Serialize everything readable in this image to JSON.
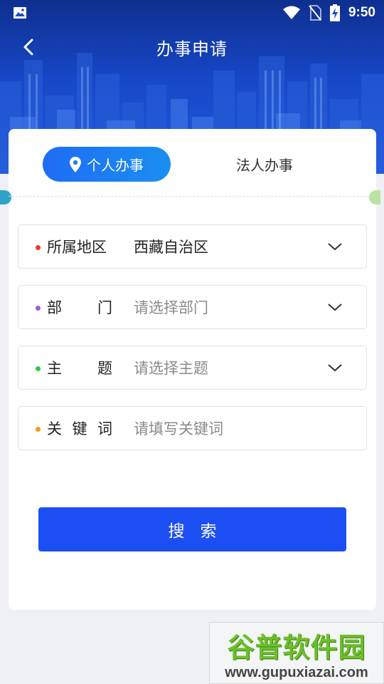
{
  "status_bar": {
    "time": "9:50",
    "icons": [
      "image-icon",
      "wifi-icon",
      "no-sim-icon",
      "battery-charging-icon"
    ]
  },
  "nav": {
    "title": "办事申请",
    "back_icon": "chevron-left-icon"
  },
  "tabs": [
    {
      "label": "个人办事",
      "active": true,
      "icon": "location-pin-icon"
    },
    {
      "label": "法人办事",
      "active": false
    }
  ],
  "fields": [
    {
      "label": "所属地区",
      "value": "西藏自治区",
      "placeholder": "",
      "dot_color": "#e53935",
      "dropdown": true
    },
    {
      "label_chars": [
        "部",
        "门"
      ],
      "value": "",
      "placeholder": "请选择部门",
      "dot_color": "#9b5de5",
      "dropdown": true
    },
    {
      "label_chars": [
        "主",
        "题"
      ],
      "value": "",
      "placeholder": "请选择主题",
      "dot_color": "#2ecc40",
      "dropdown": true
    },
    {
      "label_chars": [
        "关",
        "键",
        "词"
      ],
      "value": "",
      "placeholder": "请填写关键词",
      "dot_color": "#f39c12",
      "dropdown": false
    }
  ],
  "search_button": {
    "label": "搜索"
  },
  "watermark": {
    "title": "谷普软件园",
    "url": "www.gupuxiazai.com"
  },
  "colors": {
    "header_top": "#0e2f8f",
    "accent": "#1c4ff3",
    "tab_active": "#1f6cf5",
    "background": "#eef0f6"
  }
}
